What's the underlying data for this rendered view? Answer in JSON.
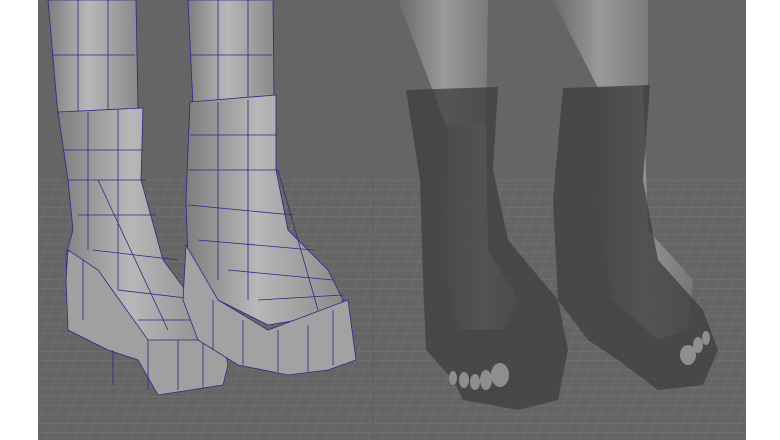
{
  "colors": {
    "background": "#656565",
    "page_border": "#ffffff",
    "wireframe": "#2a2a8a",
    "mesh_surface": "#a8a8a8",
    "translucent_boot": "#4a4a4a",
    "skin_surface": "#8c8c8c",
    "grid_line": "#7a7a7a"
  },
  "panels": [
    {
      "shading": "wireframe-on-shaded"
    },
    {
      "shading": "x-ray-translucent"
    }
  ]
}
